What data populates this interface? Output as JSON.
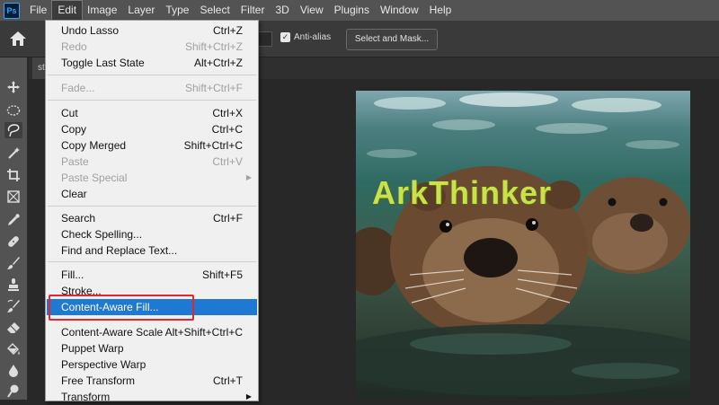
{
  "app": {
    "logo_text": "Ps"
  },
  "menubar": {
    "items": [
      "File",
      "Edit",
      "Image",
      "Layer",
      "Type",
      "Select",
      "Filter",
      "3D",
      "View",
      "Plugins",
      "Window",
      "Help"
    ],
    "active": "Edit"
  },
  "options": {
    "antialias_label": "Anti-alias",
    "antialias_checked": true,
    "select_mask_label": "Select and Mask..."
  },
  "document_tab": {
    "label": "st"
  },
  "canvas": {
    "watermark": "ArkThinker"
  },
  "edit_menu": {
    "items": [
      {
        "label": "Undo Lasso",
        "shortcut": "Ctrl+Z",
        "enabled": true
      },
      {
        "label": "Redo",
        "shortcut": "Shift+Ctrl+Z",
        "enabled": false
      },
      {
        "label": "Toggle Last State",
        "shortcut": "Alt+Ctrl+Z",
        "enabled": true
      },
      {
        "label": "Fade...",
        "shortcut": "Shift+Ctrl+F",
        "enabled": false
      },
      {
        "label": "Cut",
        "shortcut": "Ctrl+X",
        "enabled": true
      },
      {
        "label": "Copy",
        "shortcut": "Ctrl+C",
        "enabled": true
      },
      {
        "label": "Copy Merged",
        "shortcut": "Shift+Ctrl+C",
        "enabled": true
      },
      {
        "label": "Paste",
        "shortcut": "Ctrl+V",
        "enabled": false
      },
      {
        "label": "Paste Special",
        "shortcut": "",
        "enabled": false
      },
      {
        "label": "Clear",
        "shortcut": "",
        "enabled": true
      },
      {
        "label": "Search",
        "shortcut": "Ctrl+F",
        "enabled": true
      },
      {
        "label": "Check Spelling...",
        "shortcut": "",
        "enabled": true
      },
      {
        "label": "Find and Replace Text...",
        "shortcut": "",
        "enabled": true
      },
      {
        "label": "Fill...",
        "shortcut": "Shift+F5",
        "enabled": true
      },
      {
        "label": "Stroke...",
        "shortcut": "",
        "enabled": true
      },
      {
        "label": "Content-Aware Fill...",
        "shortcut": "",
        "enabled": true,
        "highlighted": true
      },
      {
        "label": "Content-Aware Scale",
        "shortcut": "Alt+Shift+Ctrl+C",
        "enabled": true
      },
      {
        "label": "Puppet Warp",
        "shortcut": "",
        "enabled": true
      },
      {
        "label": "Perspective Warp",
        "shortcut": "",
        "enabled": true
      },
      {
        "label": "Free Transform",
        "shortcut": "Ctrl+T",
        "enabled": true
      },
      {
        "label": "Transform",
        "shortcut": "",
        "enabled": true
      }
    ]
  },
  "colors": {
    "menu_highlight": "#1f78d1",
    "callout_red": "#e3262c",
    "watermark": "#c8e24a"
  }
}
